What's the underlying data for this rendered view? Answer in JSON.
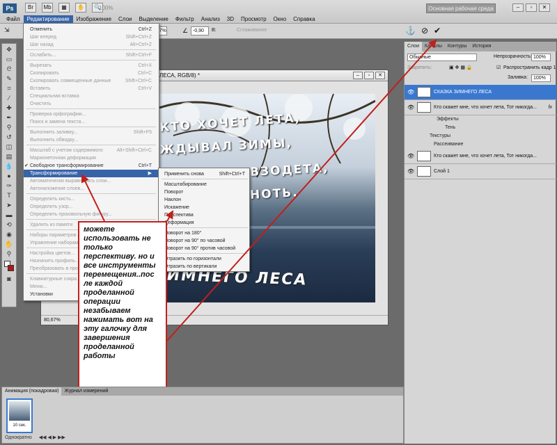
{
  "app": {
    "logo": "Ps",
    "workspace": "Основная рабочая среда",
    "zoom_top": "100%"
  },
  "menus": [
    "Файл",
    "Редактирование",
    "Изображение",
    "Слои",
    "Выделение",
    "Фильтр",
    "Анализ",
    "3D",
    "Просмотр",
    "Окно",
    "Справка"
  ],
  "options": {
    "x_label": "X:",
    "w_label": "W:",
    "w_value": "",
    "h_label": "H:",
    "h_value": "75,47%",
    "angle": "-0,90",
    "b_label": "В:",
    "antialias": "Сглаживание"
  },
  "document": {
    "title": "ЛЕСА, RGB/8) *",
    "zoom": "80,67%"
  },
  "canvas_text": [
    "КТО ХОЧЕТ ЛЕТА,",
    "ЖДЫВАЛ ЗИМЫ,",
    "ВЗОДЕТА,",
    "НОТЬ.",
    "ИМНЕГО ЛЕСА"
  ],
  "edit_menu": [
    {
      "label": "Отменить",
      "sc": "Ctrl+Z",
      "dis": false
    },
    {
      "label": "Шаг вперед",
      "sc": "Shift+Ctrl+Z",
      "dis": true
    },
    {
      "label": "Шаг назад",
      "sc": "Alt+Ctrl+Z",
      "dis": true
    },
    {
      "label": "Ослабить...",
      "sc": "Shift+Ctrl+F",
      "dis": true
    },
    {
      "label": "Вырезать",
      "sc": "Ctrl+X",
      "dis": true
    },
    {
      "label": "Скопировать",
      "sc": "Ctrl+C",
      "dis": true
    },
    {
      "label": "Скопировать совмещенные данные",
      "sc": "Shift+Ctrl+C",
      "dis": true
    },
    {
      "label": "Вставить",
      "sc": "Ctrl+V",
      "dis": true
    },
    {
      "label": "Специальная вставка",
      "sc": "",
      "dis": true
    },
    {
      "label": "Очистить",
      "sc": "",
      "dis": true
    },
    {
      "label": "Проверка орфографии...",
      "sc": "",
      "dis": true
    },
    {
      "label": "Поиск и замена текста...",
      "sc": "",
      "dis": true
    },
    {
      "label": "Выполнить заливку...",
      "sc": "Shift+F5",
      "dis": true
    },
    {
      "label": "Выполнить обводку...",
      "sc": "",
      "dis": true
    },
    {
      "label": "Масштаб с учетом содержимого",
      "sc": "Alt+Shift+Ctrl+C",
      "dis": true
    },
    {
      "label": "Марионеточная деформация",
      "sc": "",
      "dis": true
    },
    {
      "label": "Свободное трансформирование",
      "sc": "Ctrl+T",
      "dis": false,
      "chk": true
    },
    {
      "label": "Трансформирование",
      "sc": "▶",
      "dis": false,
      "hl": true
    },
    {
      "label": "Автоматически выравнивать слои...",
      "sc": "",
      "dis": true
    },
    {
      "label": "Автоналожение слоев...",
      "sc": "",
      "dis": true
    },
    {
      "label": "Определить кисть...",
      "sc": "",
      "dis": true
    },
    {
      "label": "Определить узор...",
      "sc": "",
      "dis": true
    },
    {
      "label": "Определить произвольную фигуру...",
      "sc": "",
      "dis": true
    },
    {
      "label": "Удалить из памяти",
      "sc": "",
      "dis": true
    },
    {
      "label": "Наборы параметров А...",
      "sc": "",
      "dis": true
    },
    {
      "label": "Управление наборами...",
      "sc": "",
      "dis": true
    },
    {
      "label": "Настройка цветов...",
      "sc": "",
      "dis": true
    },
    {
      "label": "Назначить профиль...",
      "sc": "",
      "dis": true
    },
    {
      "label": "Преобразовать в профиль...",
      "sc": "",
      "dis": true
    },
    {
      "label": "Клавиатурные сокра...",
      "sc": "",
      "dis": true
    },
    {
      "label": "Меню...",
      "sc": "",
      "dis": true
    },
    {
      "label": "Установки",
      "sc": "",
      "dis": false
    }
  ],
  "submenu": [
    {
      "label": "Применить снова",
      "sc": "Shift+Ctrl+T"
    },
    {
      "label": "Масштабирование",
      "sc": ""
    },
    {
      "label": "Поворот",
      "sc": ""
    },
    {
      "label": "Наклон",
      "sc": ""
    },
    {
      "label": "Искажение",
      "sc": ""
    },
    {
      "label": "Перспектива",
      "sc": ""
    },
    {
      "label": "Деформация",
      "sc": ""
    },
    {
      "label": "Поворот на 180°",
      "sc": ""
    },
    {
      "label": "Поворот на 90° по часовой",
      "sc": ""
    },
    {
      "label": "Поворот на 90° против часовой",
      "sc": ""
    },
    {
      "label": "Отразить по горизонтали",
      "sc": ""
    },
    {
      "label": "Отразить по вертикали",
      "sc": ""
    }
  ],
  "callout": "можете использовать не только перспективу. но и все инструменты перемещения..пос ле каждой проделанной операции незабываем нажимать вот на эту галочку для завершения проделанной работы",
  "panel": {
    "tabs": [
      "Слои",
      "Каналы",
      "Контуры",
      "История"
    ],
    "blend": "Обычные",
    "opacity_label": "Непрозрачность:",
    "opacity": "100%",
    "lock_label": "Закрепить:",
    "unify_label": "Распространить кадр 1",
    "fill_label": "Заливка:",
    "fill": "100%",
    "layers": [
      {
        "name": "СКАЗКА ЗИМНЕГО ЛЕСА",
        "sel": true
      },
      {
        "name": "Кто скажет мне, что хочет лета,  Тот никогда...",
        "sel": false
      },
      {
        "name": "Кто скажет мне, что хочет лета,  Тот никогда...",
        "sel": false
      },
      {
        "name": "Слой 1",
        "sel": false
      }
    ],
    "effects_label": "Эффекты",
    "shadow_label": "Тень",
    "textures_label": "Текстуры",
    "scatter_label": "Рассеивание",
    "fx": "fx"
  },
  "animation": {
    "tabs": [
      "Анимация (покадровая)",
      "Журнал измерений"
    ],
    "frame_time": "10 сек.",
    "loop": "Однократно"
  }
}
